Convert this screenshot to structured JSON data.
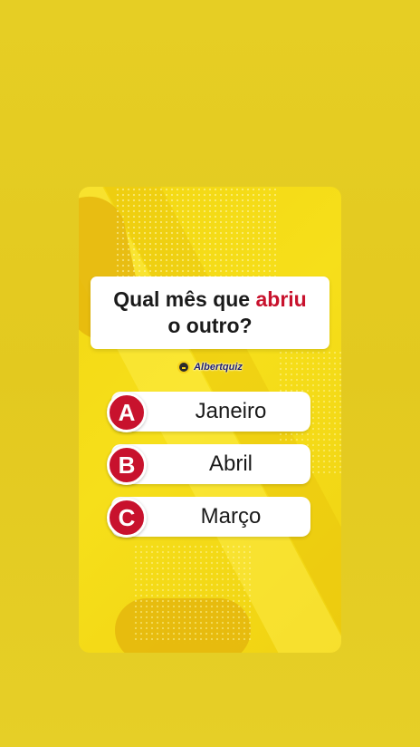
{
  "quiz": {
    "question_part1": "Qual mês que ",
    "question_highlight": "abriu",
    "question_part2": "o outro?",
    "brand": "Albertquiz",
    "options": [
      {
        "letter": "A",
        "label": "Janeiro"
      },
      {
        "letter": "B",
        "label": "Abril"
      },
      {
        "letter": "C",
        "label": "Março"
      }
    ]
  },
  "colors": {
    "background": "#e6cc22",
    "card": "#f3d713",
    "accent_red": "#c8122d",
    "answer_bg": "#ffffff"
  }
}
